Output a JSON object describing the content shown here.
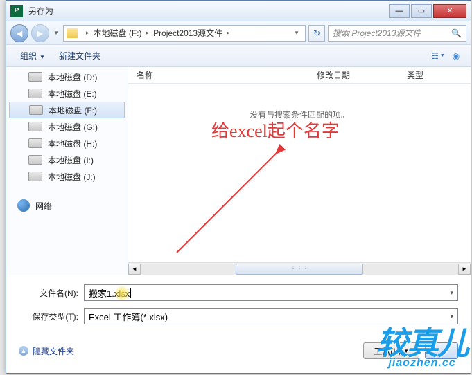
{
  "window": {
    "title": "另存为"
  },
  "nav": {
    "crumb1": "本地磁盘 (F:)",
    "crumb2": "Project2013源文件",
    "search_placeholder": "搜索 Project2013源文件"
  },
  "toolbar": {
    "organize": "组织",
    "new_folder": "新建文件夹"
  },
  "sidebar": {
    "items": [
      {
        "label": "本地磁盘 (D:)"
      },
      {
        "label": "本地磁盘 (E:)"
      },
      {
        "label": "本地磁盘 (F:)",
        "selected": true
      },
      {
        "label": "本地磁盘 (G:)"
      },
      {
        "label": "本地磁盘 (H:)"
      },
      {
        "label": "本地磁盘 (I:)"
      },
      {
        "label": "本地磁盘 (J:)"
      }
    ],
    "network": "网络"
  },
  "columns": {
    "name": "名称",
    "date": "修改日期",
    "type": "类型"
  },
  "content": {
    "empty": "没有与搜索条件匹配的项。"
  },
  "annotation": {
    "text": "给excel起个名字"
  },
  "form": {
    "filename_label": "文件名(N):",
    "filename_value": "搬家1.xlsx",
    "filetype_label": "保存类型(T):",
    "filetype_value": "Excel 工作簿(*.xlsx)"
  },
  "footer": {
    "hide_folders": "隐藏文件夹",
    "tools": "工具(L)"
  },
  "watermark": {
    "big": "较真儿",
    "small": "jiaozhen.cc"
  }
}
